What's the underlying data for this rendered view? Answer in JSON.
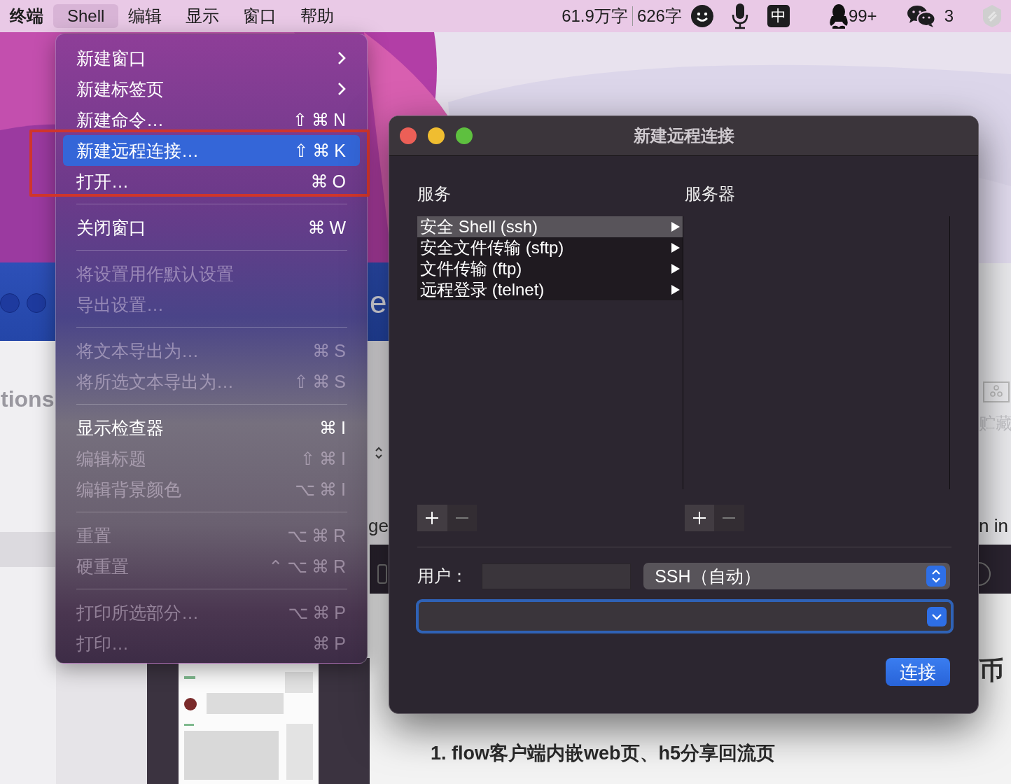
{
  "menubar": {
    "app_name": "终端",
    "menus": [
      {
        "label": "Shell",
        "selected": true
      },
      {
        "label": "编辑",
        "selected": false
      },
      {
        "label": "显示",
        "selected": false
      },
      {
        "label": "窗口",
        "selected": false
      },
      {
        "label": "帮助",
        "selected": false
      }
    ],
    "status": {
      "word_count": "61.9万字",
      "selection_count": "626字",
      "input_method": "中",
      "qq_badge": "99+",
      "wechat_badge": "3"
    }
  },
  "shell_menu": {
    "groups": [
      [
        {
          "label": "新建窗口",
          "submenu": true,
          "disabled": false,
          "selected": false
        },
        {
          "label": "新建标签页",
          "submenu": true,
          "disabled": false,
          "selected": false
        },
        {
          "label": "新建命令…",
          "shortcut": "⇧⌘N",
          "submenu": false,
          "disabled": false,
          "selected": false
        },
        {
          "label": "新建远程连接…",
          "shortcut": "⇧⌘K",
          "submenu": false,
          "disabled": false,
          "selected": true
        },
        {
          "label": "打开…",
          "shortcut": "⌘O",
          "submenu": false,
          "disabled": false,
          "selected": false
        }
      ],
      [
        {
          "label": "关闭窗口",
          "shortcut": "⌘W",
          "submenu": false,
          "disabled": false,
          "selected": false
        }
      ],
      [
        {
          "label": "将设置用作默认设置",
          "submenu": false,
          "disabled": true,
          "selected": false
        },
        {
          "label": "导出设置…",
          "submenu": false,
          "disabled": true,
          "selected": false
        }
      ],
      [
        {
          "label": "将文本导出为…",
          "shortcut": "⌘S",
          "submenu": false,
          "disabled": true,
          "selected": false
        },
        {
          "label": "将所选文本导出为…",
          "shortcut": "⇧⌘S",
          "submenu": false,
          "disabled": true,
          "selected": false
        }
      ],
      [
        {
          "label": "显示检查器",
          "shortcut": "⌘I",
          "submenu": false,
          "disabled": false,
          "selected": false
        },
        {
          "label": "编辑标题",
          "shortcut": "⇧⌘I",
          "submenu": false,
          "disabled": true,
          "selected": false
        },
        {
          "label": "编辑背景颜色",
          "shortcut": "⌥⌘I",
          "submenu": false,
          "disabled": true,
          "selected": false
        }
      ],
      [
        {
          "label": "重置",
          "shortcut": "⌥⌘R",
          "submenu": false,
          "disabled": true,
          "selected": false
        },
        {
          "label": "硬重置",
          "shortcut": "⌃⌥⌘R",
          "submenu": false,
          "disabled": true,
          "selected": false
        }
      ],
      [
        {
          "label": "打印所选部分…",
          "shortcut": "⌥⌘P",
          "submenu": false,
          "disabled": true,
          "selected": false
        },
        {
          "label": "打印…",
          "shortcut": "⌘P",
          "submenu": false,
          "disabled": true,
          "selected": false
        }
      ]
    ]
  },
  "dialog": {
    "title": "新建远程连接",
    "services_label": "服务",
    "servers_label": "服务器",
    "services": [
      {
        "label": "安全 Shell (ssh)",
        "selected": true
      },
      {
        "label": "安全文件传输 (sftp)",
        "selected": false
      },
      {
        "label": "文件传输 (ftp)",
        "selected": false
      },
      {
        "label": "远程登录 (telnet)",
        "selected": false
      }
    ],
    "user_label": "用户：",
    "protocol": "SSH（自动）",
    "connect_button": "连接"
  },
  "background": {
    "sidebar_fragment": "tions",
    "title_fragment": "e",
    "toolbar_fragment": "ge",
    "right_fragment": "n in",
    "stash_label": "贮藏",
    "heading_fragment": "币",
    "section_heading": "1. flow客户端内嵌web页、h5分享回流页"
  }
}
